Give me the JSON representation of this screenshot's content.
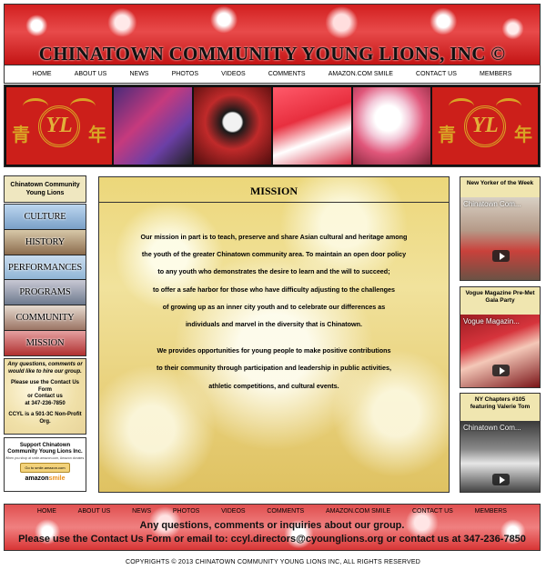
{
  "header": {
    "title": "CHINATOWN COMMUNITY YOUNG LIONS, INC ©"
  },
  "nav": {
    "items": [
      "HOME",
      "ABOUT US",
      "NEWS",
      "PHOTOS",
      "VIDEOS",
      "COMMENTS",
      "AMAZON.COM SMILE",
      "CONTACT US",
      "MEMBERS"
    ]
  },
  "emblem": {
    "left_char": "青",
    "right_char": "年",
    "monogram": "YL"
  },
  "sidebar": {
    "title": "Chinatown Community Young Lions",
    "items": [
      "CULTURE",
      "HISTORY",
      "PERFORMANCES",
      "PROGRAMS",
      "COMMUNITY",
      "MISSION"
    ],
    "contact": {
      "question": "Any questions, comments or would like to hire our group.",
      "please": "Please use the Contact Us Form",
      "or": "or Contact us",
      "phone": "at 347-236-7850",
      "nonprofit": "CCYL is a 501-3C Non-Profit Org."
    },
    "amazon": {
      "support": "Support Chinatown Community Young Lions Inc.",
      "fine": "When you shop at smile.amazon.com, Amazon donates.",
      "button": "Go to smile.amazon.com",
      "logo_main": "amazon",
      "logo_accent": "smile"
    }
  },
  "mission": {
    "title": "MISSION",
    "lines": [
      "Our mission in part is to teach, preserve and share Asian cultural and heritage among",
      "the youth of the greater Chinatown community area. To maintain an open door policy",
      "to any youth who demonstrates the desire to learn and the will to succeed;",
      "to offer a safe harbor for those who have difficulty adjusting to the challenges",
      "of growing up as an inner city youth and to celebrate our differences as",
      "individuals and marvel in the diversity that is Chinatown."
    ],
    "lines2": [
      "We provides opportunities for young people to make positive contributions",
      "to their community through participation and leadership in public activities,",
      "athletic competitions, and cultural events."
    ]
  },
  "videos": [
    {
      "caption": "New Yorker of the Week",
      "title": "Chinatown Com..."
    },
    {
      "caption": "Vogue Magazine Pre-Met Gala Party",
      "title": "Vogue Magazin..."
    },
    {
      "caption": "NY Chapters #105 featuring Valerie Tom",
      "title": "Chinatown Com..."
    }
  ],
  "footer": {
    "line1": "Any questions, comments or inquiries about our group.",
    "line2": "Please use the Contact Us Form or email to: ccyl.directors@cyounglions.org or contact us at 347-236-7850",
    "copyright": "COPYRIGHTS © 2013 CHINATOWN COMMUNITY YOUNG LIONS INC, ALL RIGHTS RESERVED"
  }
}
